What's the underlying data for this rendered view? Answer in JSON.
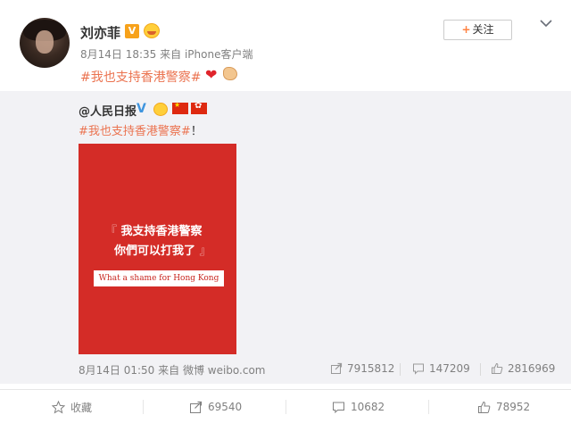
{
  "post": {
    "author": "刘亦菲",
    "vip_badge": "V",
    "time": "8月14日 18:35",
    "source": "来自 iPhone客户端",
    "text": "#我也支持香港警察#",
    "follow_label": "关注",
    "follow_plus": "+"
  },
  "repost": {
    "author": "@人民日报",
    "verified_badge": "V",
    "text_tag": "#我也支持香港警察#",
    "text_suffix": "！",
    "poster": {
      "line1_open": "『",
      "line1": "我支持香港警察",
      "line2": "你們可以打我了",
      "line2_close": "』",
      "banner": "What a shame for Hong Kong",
      "background_color": "#d42c27"
    },
    "time": "8月14日 01:50",
    "source": "来自 微博 weibo.com",
    "reposts": "7915812",
    "comments": "147209",
    "likes": "2816969"
  },
  "actions": {
    "favorite_label": "收藏",
    "repost_count": "69540",
    "comment_count": "10682",
    "like_count": "78952"
  },
  "colors": {
    "topic": "#eb7350",
    "verified": "#3f95de",
    "follow_plus": "#ff8140",
    "repost_background": "#f2f2f5"
  },
  "icons": [
    "chevron-down-icon",
    "heart-icon",
    "muscle-icon",
    "repost-icon",
    "comment-icon",
    "like-icon",
    "star-icon"
  ]
}
